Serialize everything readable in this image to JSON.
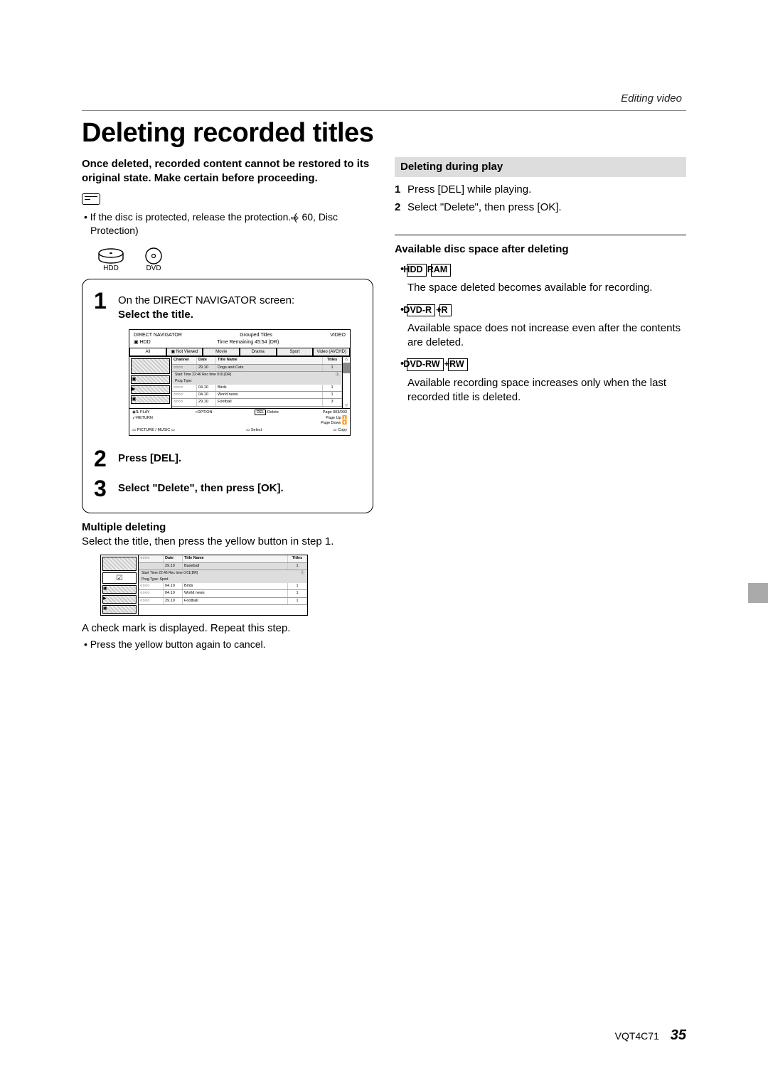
{
  "breadcrumb": "Editing video",
  "title": "Deleting recorded titles",
  "left": {
    "warning": "Once deleted, recorded content cannot be restored to its original state. Make certain before proceeding.",
    "note": "If the disc is protected, release the protection. (",
    "note_ref": "60, Disc Protection)",
    "hdd_label": "HDD",
    "dvd_label": "DVD",
    "step1_a": "On the DIRECT NAVIGATOR screen:",
    "step1_b": "Select the title.",
    "step2": "Press [DEL].",
    "step3": "Select \"Delete\", then press [OK].",
    "multiple_h": "Multiple deleting",
    "multiple_t": "Select the title, then press the yellow button in step 1.",
    "check_t": "A check mark is displayed. Repeat this step.",
    "cancel_t": "Press the yellow button again to cancel."
  },
  "nav": {
    "title": "DIRECT NAVIGATOR",
    "hdd": "HDD",
    "grouped": "Grouped Titles",
    "time": "Time Remaining  45:54 (DR)",
    "video": "VIDEO",
    "tabs": [
      "All",
      "Not Viewed",
      "Movie",
      "Drama",
      "Sport",
      "Video (AVCHD)"
    ],
    "cols": {
      "ch": "Channel",
      "dt": "Date",
      "tn": "Title Name",
      "tt": "Titles"
    },
    "hl_date": "29.10",
    "hl_title": "Dogs and Cats",
    "hl_start": "Start Time 22:46   Rec time 0:01(DR)",
    "hl_prog": "Prog.Type:",
    "rows": [
      {
        "ch": "○○○○",
        "dt": "04.10",
        "tn": "Birds",
        "tt": "1"
      },
      {
        "ch": "○○○○",
        "dt": "04.10",
        "tn": "World news",
        "tt": "1"
      },
      {
        "ch": "○○○○",
        "dt": "29.10",
        "tn": "Football",
        "tt": "3"
      }
    ],
    "foot": {
      "play": "PLAY",
      "return": "RETURN",
      "option": "OPTION",
      "del": "DEL",
      "delete": "Delete",
      "page": "Page 003/003",
      "pup": "Page Up",
      "pdn": "Page Down",
      "pic": "PICTURE / MUSIC",
      "select": "Select",
      "copy": "Copy"
    }
  },
  "mini": {
    "cols": {
      "dt": "Date",
      "tn": "Title Name",
      "tt": "Titles"
    },
    "hl_date": "29.10",
    "hl_title": "Baseball",
    "hl_start": "Start Time 22:46   Rec time 0:01(DR)",
    "hl_prog": "Prog.Type: Sport",
    "rows": [
      {
        "dt": "04.10",
        "tn": "Birds",
        "tt": "1"
      },
      {
        "dt": "04.10",
        "tn": "World news",
        "tt": "1"
      },
      {
        "dt": "29.10",
        "tn": "Football",
        "tt": "1"
      }
    ],
    "tt1": "1"
  },
  "right": {
    "del_play_h": "Deleting during play",
    "s1": "Press [DEL] while playing.",
    "s2": "Select \"Delete\", then press [OK].",
    "avail_h": "Available disc space after deleting",
    "b1a": "HDD",
    "b1b": "RAM",
    "t1": "The space deleted becomes available for recording.",
    "b2a": "DVD-R",
    "b2b": "+R",
    "t2": "Available space does not increase even after the contents are deleted.",
    "b3a": "DVD-RW",
    "b3b": "+RW",
    "t3": "Available recording space increases only when the last recorded title is deleted."
  },
  "footer": {
    "code": "VQT4C71",
    "page": "35"
  }
}
